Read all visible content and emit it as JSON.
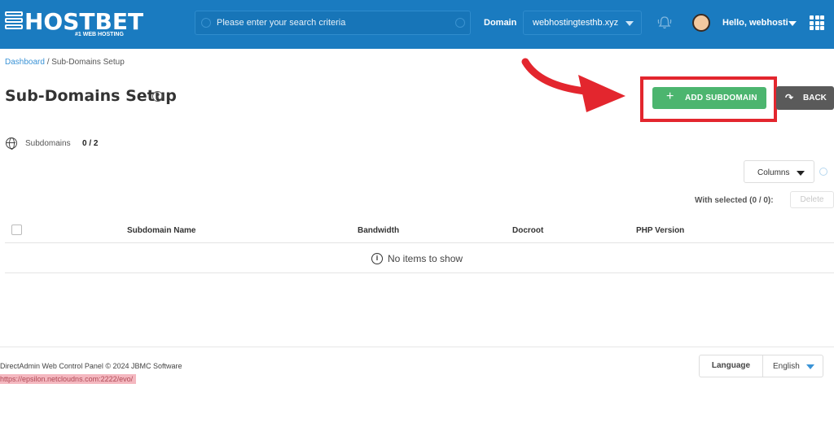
{
  "brand": {
    "name": "HOSTBET",
    "tagline": "#1 WEB HOSTING"
  },
  "header": {
    "search_placeholder": "Please enter your search criteria",
    "domain_label": "Domain",
    "domain_value": "webhostingtesthb.xyz",
    "user_greeting": "Hello, webhosti"
  },
  "breadcrumb": {
    "root": "Dashboard",
    "separator": " / ",
    "current": "Sub-Domains Setup"
  },
  "page": {
    "title": "Sub-Domains Setup",
    "help_glyph": "?",
    "add_button": "ADD SUBDOMAIN",
    "add_icon": "+",
    "back_button": "BACK",
    "back_icon": "↷"
  },
  "stats": {
    "label": "Subdomains",
    "count": "0 / 2"
  },
  "table": {
    "columns_button": "Columns",
    "with_selected": "With selected (0 / 0):",
    "delete_button": "Delete",
    "headers": [
      "Subdomain Name",
      "Bandwidth",
      "Docroot",
      "PHP Version"
    ],
    "empty_message": "No items to show",
    "info_glyph": "i"
  },
  "footer": {
    "copyright": "DirectAdmin Web Control Panel © 2024 JBMC Software",
    "url": "https://epsilon.netcloudns.com:2222/evo/",
    "language_label": "Language",
    "language_value": "English"
  },
  "colors": {
    "header_bg": "#1a7bc0",
    "add_button": "#4cb56f",
    "back_button": "#5a5a5a",
    "highlight": "#e3262e"
  },
  "icons": [
    "grid-apps-icon",
    "bell-icon",
    "search-icon",
    "globe-icon",
    "help-icon",
    "info-icon",
    "refresh-icon",
    "share-icon",
    "plus-icon"
  ]
}
